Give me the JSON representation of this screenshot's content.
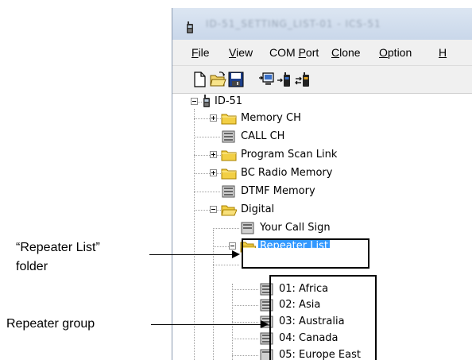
{
  "window": {
    "title": "ID-51_SETTING_LIST-01 - ICS-51"
  },
  "menu": {
    "items": [
      {
        "label": "File",
        "mnemonic": "F",
        "rest": "ile"
      },
      {
        "label": "View",
        "mnemonic": "V",
        "rest": "iew"
      },
      {
        "label": "COM Port",
        "pre": "COM ",
        "mnemonic": "P",
        "rest": "ort"
      },
      {
        "label": "Clone",
        "mnemonic": "C",
        "rest": "lone"
      },
      {
        "label": "Option",
        "mnemonic": "O",
        "rest": "ption"
      },
      {
        "label": "H",
        "mnemonic": "H",
        "rest": ""
      }
    ]
  },
  "toolbar": {
    "buttons": [
      "new-file-icon",
      "open-folder-icon",
      "save-disk-icon",
      "clone-write-icon",
      "clone-read-icon",
      "clone-icon"
    ]
  },
  "tree": {
    "root": "ID-51",
    "memory_ch": "Memory CH",
    "call_ch": "CALL CH",
    "program_scan_link": "Program Scan Link",
    "bc_radio_memory": "BC Radio Memory",
    "dtmf_memory": "DTMF Memory",
    "digital": "Digital",
    "your_call_sign": "Your Call Sign",
    "repeater_list": "Repeater List",
    "groups": [
      "01: Africa",
      "02: Asia",
      "03: Australia",
      "04: Canada",
      "05: Europe East"
    ]
  },
  "callouts": {
    "repeater_folder_line1": "“Repeater List”",
    "repeater_folder_line2": "folder",
    "repeater_group": "Repeater group"
  }
}
